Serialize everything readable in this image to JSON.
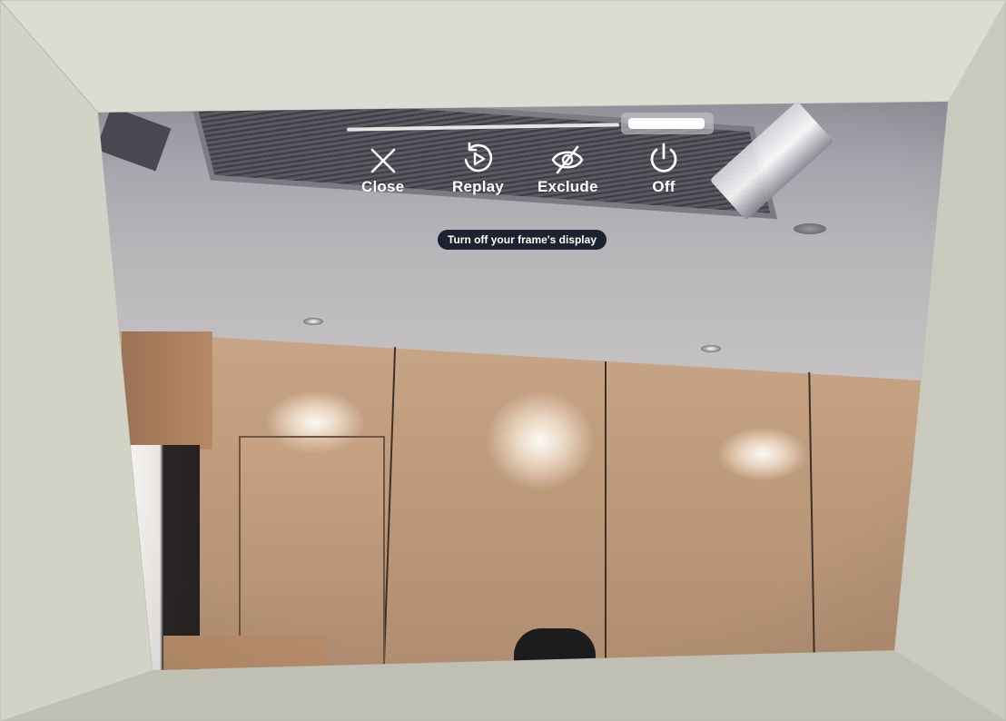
{
  "overlay": {
    "progress": 0.72,
    "controls": [
      {
        "label": "Close",
        "icon": "close-icon"
      },
      {
        "label": "Replay",
        "icon": "replay-icon"
      },
      {
        "label": "Exclude",
        "icon": "eye-off-icon"
      },
      {
        "label": "Off",
        "icon": "power-icon"
      }
    ],
    "tooltip": "Turn off your frame's display"
  },
  "colors": {
    "overlay_text": "#ffffff",
    "tooltip_bg": "#1d2230",
    "frame": "#d4d5c9"
  }
}
